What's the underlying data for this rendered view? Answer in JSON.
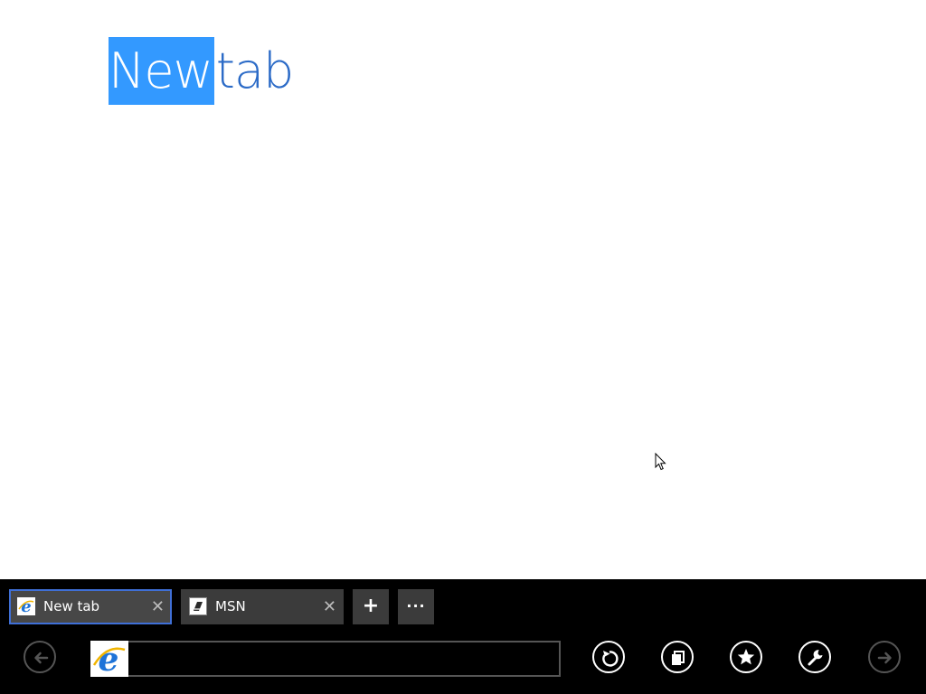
{
  "page": {
    "title_selected": "New",
    "title_rest": "tab"
  },
  "tabs": [
    {
      "label": "New tab",
      "icon": "ie-icon",
      "active": true
    },
    {
      "label": "MSN",
      "icon": "msn-icon",
      "active": false
    }
  ],
  "tab_close_glyph": "✕",
  "new_tab_glyph": "+",
  "more_glyph": "···",
  "address_bar": {
    "value": "",
    "placeholder": ""
  },
  "colors": {
    "accent": "#3399ff",
    "title_text": "#2c6bc7",
    "appbar_bg": "#000000",
    "tab_bg": "#3b3b3b",
    "active_tab_border": "#3f6fd6"
  }
}
